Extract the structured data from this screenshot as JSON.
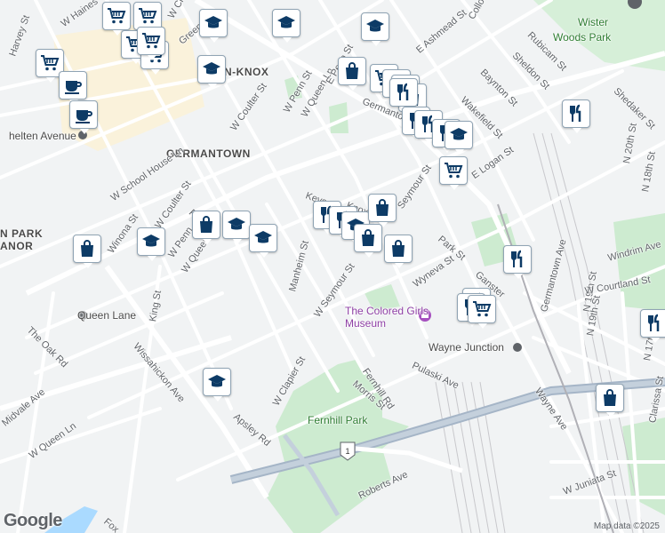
{
  "map": {
    "neighborhoods": [
      {
        "id": "germantown",
        "text": "GERMANTOWN"
      },
      {
        "id": "penn-knox",
        "text": "N-KNOX"
      },
      {
        "id": "park-manor-1",
        "text": "N PARK"
      },
      {
        "id": "park-manor-2",
        "text": "ANOR"
      }
    ],
    "parks": [
      {
        "id": "wister",
        "text": "Wister"
      },
      {
        "id": "woods-park",
        "text": "Woods Park"
      },
      {
        "id": "fernhill",
        "text": "Fernhill Park"
      }
    ],
    "pois": [
      {
        "id": "queen-lane",
        "text": "Queen Lane"
      },
      {
        "id": "wayne-junction",
        "text": "Wayne Junction"
      },
      {
        "id": "chelten-avenue",
        "text": "helten Avenue"
      },
      {
        "id": "museum",
        "text": "The Colored Girls Museum"
      }
    ],
    "streets": [
      {
        "id": "s1",
        "text": "Harvey St"
      },
      {
        "id": "s2",
        "text": "W Haines"
      },
      {
        "id": "s3",
        "text": "W Chelten"
      },
      {
        "id": "s4",
        "text": "Greene"
      },
      {
        "id": "s5",
        "text": "W Coulter St"
      },
      {
        "id": "s6",
        "text": "W Penn St"
      },
      {
        "id": "s7",
        "text": "W Queen Ln"
      },
      {
        "id": "s8",
        "text": "E Penn St"
      },
      {
        "id": "s9",
        "text": "E Ashmead St"
      },
      {
        "id": "s10",
        "text": "Collom"
      },
      {
        "id": "s11",
        "text": "Rubicam St"
      },
      {
        "id": "s12",
        "text": "Sheldon St"
      },
      {
        "id": "s13",
        "text": "Baynton St"
      },
      {
        "id": "s14",
        "text": "Shedaker St"
      },
      {
        "id": "s15",
        "text": "Wakefield St"
      },
      {
        "id": "s16",
        "text": "Germantown"
      },
      {
        "id": "s17",
        "text": "W School House Ln"
      },
      {
        "id": "s18",
        "text": "Winona St"
      },
      {
        "id": "s19",
        "text": "W Coulter St"
      },
      {
        "id": "s20",
        "text": "Pulaski"
      },
      {
        "id": "s21",
        "text": "W Penn"
      },
      {
        "id": "s22",
        "text": "W Queen"
      },
      {
        "id": "s23",
        "text": "Manheim St"
      },
      {
        "id": "s24",
        "text": "W Seymour St"
      },
      {
        "id": "s25",
        "text": "Keyser"
      },
      {
        "id": "s26",
        "text": "Knox"
      },
      {
        "id": "s27",
        "text": "Seymour St"
      },
      {
        "id": "s28",
        "text": "E Logan St"
      },
      {
        "id": "s29",
        "text": "Wyneva St"
      },
      {
        "id": "s30",
        "text": "Germantown Ave"
      },
      {
        "id": "s31",
        "text": "King St"
      },
      {
        "id": "s32",
        "text": "The Oak Rd"
      },
      {
        "id": "s33",
        "text": "Wissahickon Ave"
      },
      {
        "id": "s34",
        "text": "Midvale Ave"
      },
      {
        "id": "s35",
        "text": "W Queen Ln"
      },
      {
        "id": "s36",
        "text": "W Clapier St"
      },
      {
        "id": "s37",
        "text": "Apsley Rd"
      },
      {
        "id": "s38",
        "text": "Morris St"
      },
      {
        "id": "s39",
        "text": "Fernhill Rd"
      },
      {
        "id": "s40",
        "text": "Pulaski Ave"
      },
      {
        "id": "s41",
        "text": "Clarissa St"
      },
      {
        "id": "s42",
        "text": "Wayne Ave"
      },
      {
        "id": "s43",
        "text": "Roberts Ave"
      },
      {
        "id": "s44",
        "text": "W Juniata St"
      },
      {
        "id": "s45",
        "text": "N 19th St"
      },
      {
        "id": "s46",
        "text": "N 18th St"
      },
      {
        "id": "s47",
        "text": "Windrim Ave"
      },
      {
        "id": "s48",
        "text": "W Courtland St"
      },
      {
        "id": "s49",
        "text": "N 19th St"
      },
      {
        "id": "s50",
        "text": "N 17th St"
      },
      {
        "id": "s51",
        "text": "Fox"
      },
      {
        "id": "s52",
        "text": "N 20th St"
      },
      {
        "id": "s53",
        "text": "Ganster"
      },
      {
        "id": "s54",
        "text": "Park St"
      }
    ],
    "highway_shield": "1",
    "markers": [
      {
        "type": "shopping-cart"
      },
      {
        "type": "shopping-cart"
      },
      {
        "type": "shopping-cart"
      },
      {
        "type": "shopping-cart"
      },
      {
        "type": "shopping-cart"
      },
      {
        "type": "school"
      },
      {
        "type": "school"
      },
      {
        "type": "school"
      },
      {
        "type": "shopping-cart"
      },
      {
        "type": "coffee"
      },
      {
        "type": "coffee"
      },
      {
        "type": "school"
      },
      {
        "type": "shopping-bag"
      },
      {
        "type": "shopping-cart"
      },
      {
        "type": "shopping-bag"
      },
      {
        "type": "shopping-bag"
      },
      {
        "type": "shopping-bag"
      },
      {
        "type": "restaurant"
      },
      {
        "type": "restaurant"
      },
      {
        "type": "restaurant"
      },
      {
        "type": "restaurant"
      },
      {
        "type": "school"
      },
      {
        "type": "shopping-cart"
      },
      {
        "type": "restaurant"
      },
      {
        "type": "shopping-bag"
      },
      {
        "type": "school"
      },
      {
        "type": "school"
      },
      {
        "type": "school"
      },
      {
        "type": "shopping-bag"
      },
      {
        "type": "restaurant"
      },
      {
        "type": "restaurant"
      },
      {
        "type": "school"
      },
      {
        "type": "shopping-bag"
      },
      {
        "type": "shopping-bag"
      },
      {
        "type": "shopping-bag"
      },
      {
        "type": "restaurant"
      },
      {
        "type": "restaurant"
      },
      {
        "type": "restaurant"
      },
      {
        "type": "shopping-cart"
      },
      {
        "type": "shopping-bag"
      },
      {
        "type": "restaurant"
      },
      {
        "type": "school"
      }
    ],
    "icon_color": "#0d3b66",
    "attribution": "Map data ©2025",
    "logo": "Google"
  }
}
